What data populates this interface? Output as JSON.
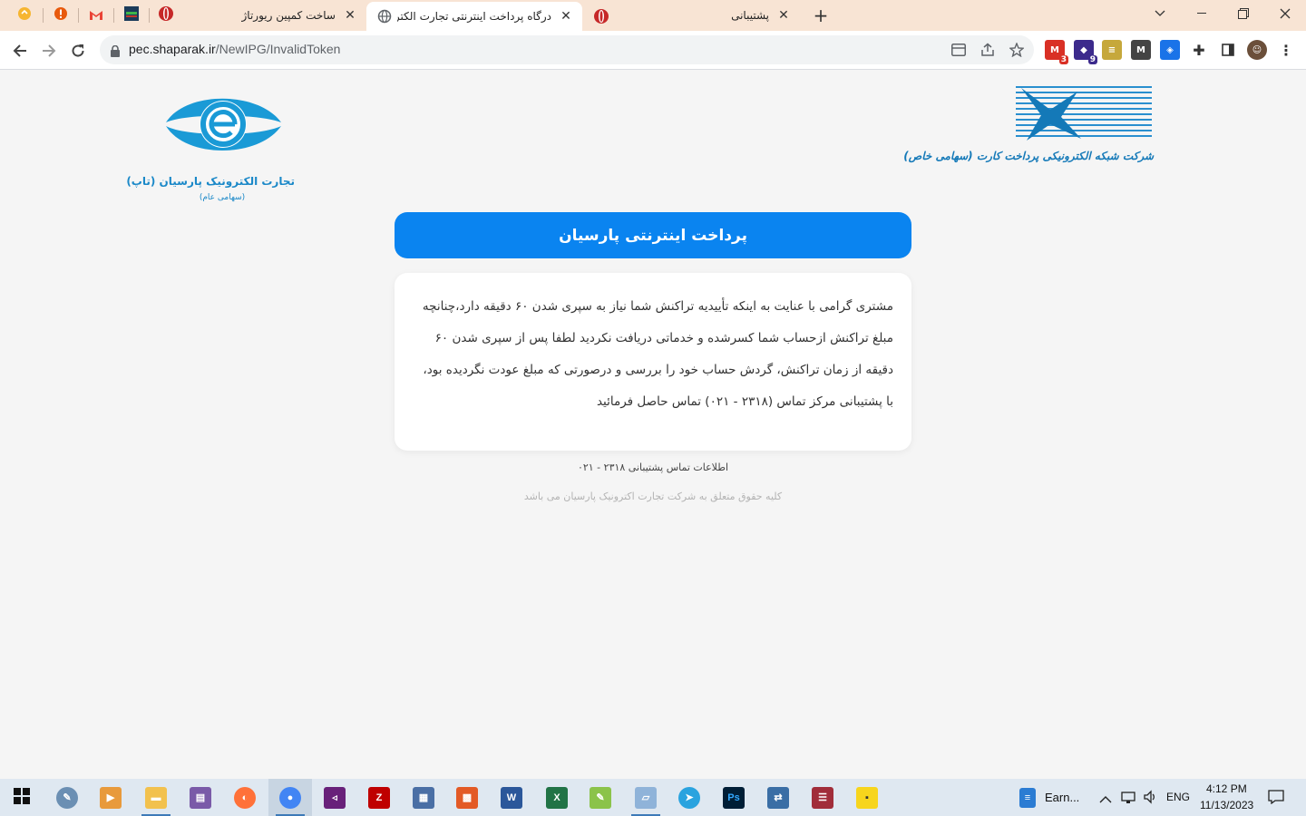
{
  "browser": {
    "pinned_tabs": [
      {
        "icon": "yellow-circle-icon",
        "color": "#f6b531"
      },
      {
        "icon": "alert-icon",
        "color": "#e8590c"
      },
      {
        "icon": "gmail-icon",
        "color": "#ea4335"
      },
      {
        "icon": "dark-app-icon",
        "color": "#1b3b5a"
      },
      {
        "icon": "red-shield-icon",
        "color": "#c62828"
      }
    ],
    "tabs": [
      {
        "title": "ساخت کمپین ریورتاژ",
        "active": false
      },
      {
        "title": "درگاه پرداخت اینترنتی تجارت الکترونیک پ",
        "active": true
      },
      {
        "title": "پشتیبانی",
        "active": false
      }
    ],
    "url_host": "pec.shaparak.ir",
    "url_path": "/NewIPG/InvalidToken",
    "extensions": [
      {
        "icon": "gmail-ext-icon",
        "badge": "3",
        "color": "#d93025"
      },
      {
        "icon": "hat-ext-icon",
        "badge": "9",
        "color": "#3c2a8c"
      },
      {
        "icon": "stack-ext-icon",
        "badge": "",
        "color": "#c6a83b"
      },
      {
        "icon": "m-ext-icon",
        "badge": "",
        "color": "#444"
      },
      {
        "icon": "tag-ext-icon",
        "badge": "",
        "color": "#1a73e8"
      }
    ]
  },
  "page": {
    "logo_left_text": "تجارت الکترونیک پارسیان (تاپ)",
    "logo_left_sub": "(سهامی عام)",
    "logo_right_text": "شرکت شبکه الکترونیکی پرداخت کارت (سهامی خاص)",
    "header_title": "پرداخت اینترنتی پارسیان",
    "message": "مشتری گرامی با عنایت به اینکه تأییدیه تراکنش شما نیاز به سپری شدن ۶۰ دقیقه دارد،چنانچه مبلغ تراکنش ازحساب شما کسرشده و خدماتی دریافت نکردید لطفا پس از سپری شدن ۶۰ دقیقه از زمان تراکنش، گردش حساب خود را بررسی و درصورتی که مبلغ عودت نگردیده بود، با پشتیبانی مرکز تماس (۲۳۱۸ - ۰۲۱) تماس حاصل فرمائید",
    "support_line": "اطلاعات تماس پشتیبانی ۲۳۱۸ - ۰۲۱",
    "copyright": "کلیه حقوق متعلق به شرکت تجارت اکترونیک پارسیان می باشد"
  },
  "taskbar": {
    "apps": [
      {
        "icon": "start-icon"
      },
      {
        "icon": "paint-app-icon",
        "color": "#6b8fb3"
      },
      {
        "icon": "media-player-icon",
        "color": "#e89a3c"
      },
      {
        "icon": "file-explorer-icon",
        "color": "#f2c14e"
      },
      {
        "icon": "winrar-icon",
        "color": "#7a5aa8"
      },
      {
        "icon": "firefox-icon",
        "color": "#ff7139"
      },
      {
        "icon": "chrome-icon",
        "color": "#4285f4"
      },
      {
        "icon": "visual-studio-icon",
        "color": "#68217a"
      },
      {
        "icon": "filezilla-icon",
        "color": "#bf0000"
      },
      {
        "icon": "network-icon",
        "color": "#4a6fa5"
      },
      {
        "icon": "office-icon",
        "color": "#e35a26"
      },
      {
        "icon": "word-icon",
        "color": "#2b579a"
      },
      {
        "icon": "excel-icon",
        "color": "#217346"
      },
      {
        "icon": "notepadpp-icon",
        "color": "#8bc34a"
      },
      {
        "icon": "tablet-app-icon",
        "color": "#8fb3d9"
      },
      {
        "icon": "telegram-icon",
        "color": "#2aa3df"
      },
      {
        "icon": "photoshop-icon",
        "color": "#001e36"
      },
      {
        "icon": "remote-icon",
        "color": "#3a6ea5"
      },
      {
        "icon": "app-red-icon",
        "color": "#a12d3a"
      },
      {
        "icon": "sticky-notes-icon",
        "color": "#f7d51d"
      }
    ],
    "word_task": "Earn...",
    "lang": "ENG",
    "time": "4:12 PM",
    "date": "11/13/2023"
  }
}
